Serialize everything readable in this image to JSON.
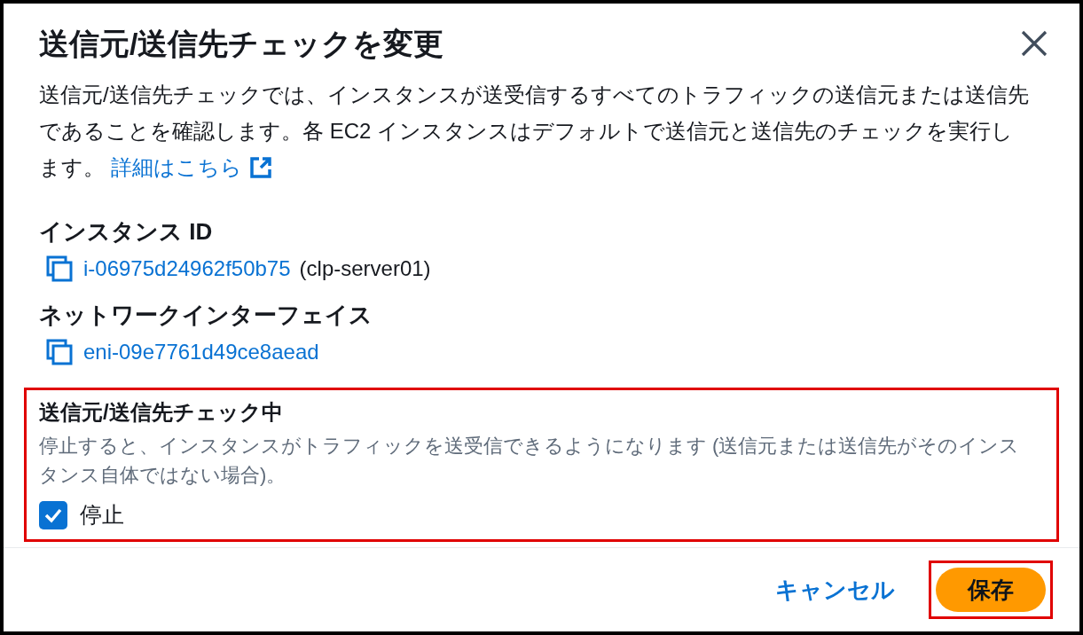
{
  "dialog": {
    "title": "送信元/送信先チェックを変更",
    "description": "送信元/送信先チェックでは、インスタンスが送受信するすべてのトラフィックの送信元または送信先であることを確認します。各 EC2 インスタンスはデフォルトで送信元と送信先のチェックを実行します。",
    "link": "詳細はこちら",
    "fields": [
      {
        "label": "インスタンス ID",
        "value": "i-06975d24962f50b75",
        "suffix": "(clp-server01)"
      },
      {
        "label": "ネットワークインターフェイス",
        "value": "eni-09e7761d49ce8aead"
      }
    ],
    "source_dest_check": {
      "label": "送信元/送信先チェック中",
      "description": "停止すると、インスタンスがトラフィックを送受信できるようになります (送信元または送信先がそのインスタンス自体ではない場合)。",
      "checkbox": {
        "label": "停止",
        "checked": true
      }
    },
    "buttons": [
      {
        "label": "キャンセル",
        "kind": "link"
      },
      {
        "label": "保存",
        "kind": "primary"
      }
    ]
  }
}
